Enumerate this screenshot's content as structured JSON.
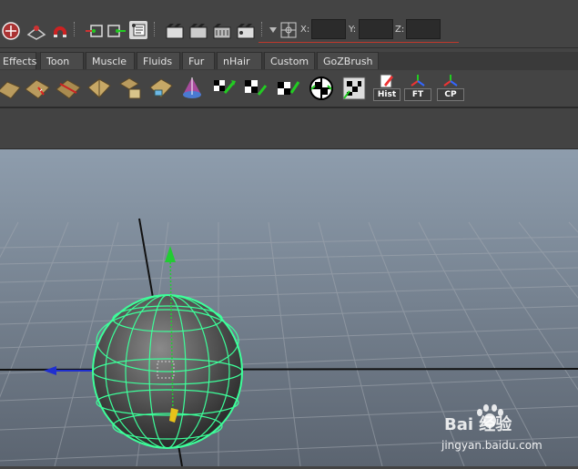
{
  "coords": {
    "x_label": "X:",
    "y_label": "Y:",
    "z_label": "Z:",
    "x_value": "",
    "y_value": "",
    "z_value": ""
  },
  "shelf_tabs": [
    "Effects",
    "Toon",
    "Muscle",
    "Fluids",
    "Fur",
    "nHair",
    "Custom",
    "GoZBrush"
  ],
  "shelf_labels": {
    "hist": "Hist",
    "ft": "FT",
    "cp": "CP"
  },
  "watermark": {
    "brand": "Bai 经验",
    "url": "jingyan.baidu.com"
  },
  "colors": {
    "ui_bg": "#444444",
    "viewport_top": "#8c9bab",
    "viewport_bottom": "#5d6673",
    "wire": "#3dff9a",
    "axis_blue": "#1f2fd0",
    "axis_green": "#22cc33",
    "accent_red": "#c0392b"
  }
}
